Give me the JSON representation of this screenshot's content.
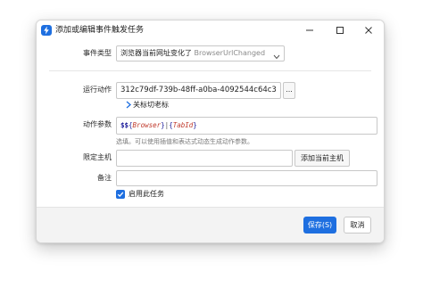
{
  "window": {
    "title": "添加或编辑事件触发任务"
  },
  "form": {
    "event_type": {
      "label": "事件类型",
      "value_cn": "浏览器当前网址变化了",
      "value_en": "BrowserUrlChanged"
    },
    "action": {
      "label": "运行动作",
      "value": "312c79df-739b-48ff-a0ba-4092544c64c3",
      "browse_label": "...",
      "link_label": "关标切老标"
    },
    "params": {
      "label": "动作参数",
      "tokens": [
        "$$",
        "{",
        "Browser",
        "}",
        "|",
        "{",
        "TabId",
        "}"
      ],
      "hint": "选填。可以使用插值和表达式动态生成动作参数。"
    },
    "host": {
      "label": "限定主机",
      "value": "",
      "button_label": "添加当前主机"
    },
    "remark": {
      "label": "备注",
      "value": ""
    },
    "enable": {
      "label": "启用此任务",
      "checked": true
    }
  },
  "footer": {
    "save_label": "保存(S)",
    "cancel_label": "取消"
  },
  "colors": {
    "accent": "#1e6fe0",
    "token_var": "#c0392b",
    "token_symbol": "#1a1a99"
  }
}
